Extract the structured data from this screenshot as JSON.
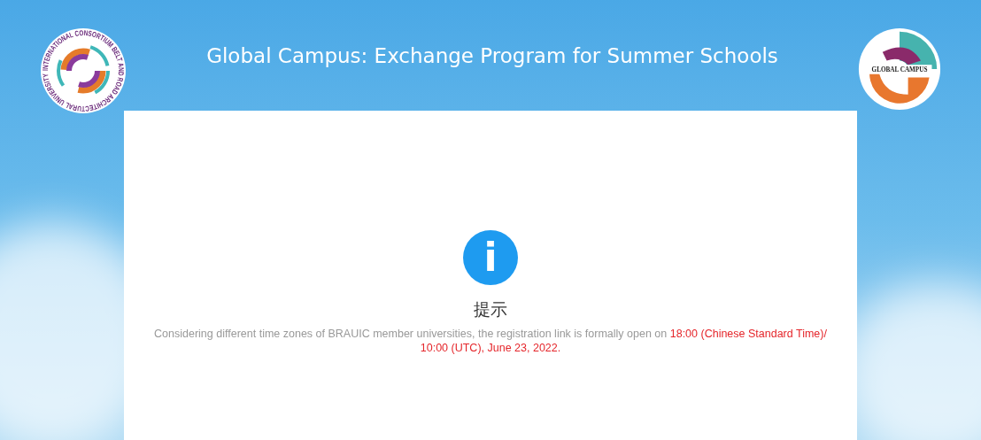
{
  "header": {
    "title": "Global Campus: Exchange Program for Summer Schools",
    "left_logo": {
      "ring_text": "INTERNATIONAL CONSORTIUM BELT AND ROAD ARCHITECTURAL UNIVERSITY"
    },
    "right_logo": {
      "text": "GLOBAL CAMPUS"
    }
  },
  "notice": {
    "icon": "i",
    "title": "提示",
    "message": "Considering different time zones of BRAUIC member universities, the registration link is formally open on ",
    "highlight": "18:00 (Chinese Standard Time)/ 10:00 (UTC), June 23, 2022."
  }
}
